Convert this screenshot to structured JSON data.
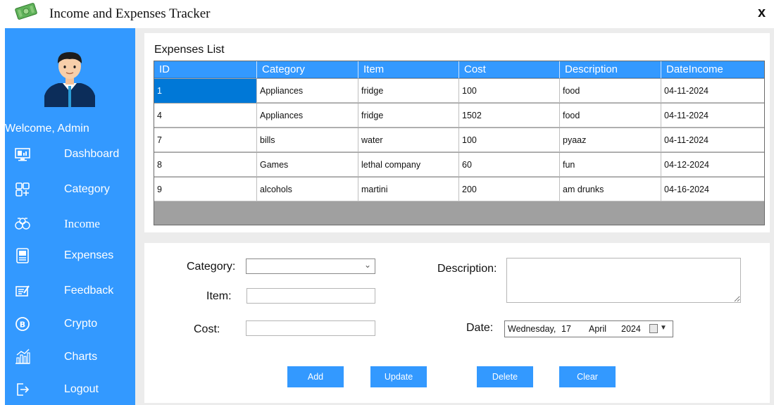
{
  "window": {
    "title": "Income and Expenses Tracker",
    "close_label": "x"
  },
  "sidebar": {
    "welcome": "Welcome, Admin",
    "items": [
      {
        "label": "Dashboard",
        "icon": "dashboard-icon"
      },
      {
        "label": "Category",
        "icon": "category-grid-icon"
      },
      {
        "label": "Income",
        "icon": "money-bags-icon"
      },
      {
        "label": "Expenses",
        "icon": "receipt-icon"
      },
      {
        "label": "Feedback",
        "icon": "feedback-icon"
      },
      {
        "label": "Crypto",
        "icon": "bitcoin-icon"
      },
      {
        "label": "Charts",
        "icon": "charts-icon"
      },
      {
        "label": "Logout",
        "icon": "logout-icon"
      }
    ]
  },
  "expenses": {
    "title": "Expenses List",
    "columns": [
      "ID",
      "Category",
      "Item",
      "Cost",
      "Description",
      "DateIncome"
    ],
    "rows": [
      [
        "1",
        "Appliances",
        "fridge",
        "100",
        "food",
        "04-11-2024"
      ],
      [
        "4",
        "Appliances",
        "fridge",
        "1502",
        "food",
        "04-11-2024"
      ],
      [
        "7",
        "bills",
        "water",
        "100",
        "pyaaz",
        "04-11-2024"
      ],
      [
        "8",
        "Games",
        "lethal company",
        "60",
        "fun",
        "04-12-2024"
      ],
      [
        "9",
        "alcohols",
        "martini",
        "200",
        "am drunks",
        "04-16-2024"
      ]
    ]
  },
  "form": {
    "category_label": "Category:",
    "category_value": "",
    "item_label": "Item:",
    "item_value": "",
    "cost_label": "Cost:",
    "cost_value": "",
    "description_label": "Description:",
    "description_value": "",
    "date_label": "Date:",
    "date_weekday": "Wednesday,",
    "date_day": "17",
    "date_month": "April",
    "date_year": "2024"
  },
  "buttons": {
    "add": "Add",
    "update": "Update",
    "delete": "Delete",
    "clear": "Clear"
  },
  "colors": {
    "accent": "#3399ff",
    "selected_row": "#0078d7",
    "panel_bg": "#ececec"
  }
}
